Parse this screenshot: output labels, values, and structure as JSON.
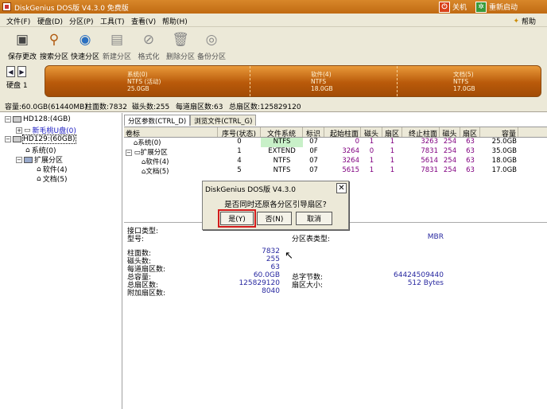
{
  "window": {
    "title": "DiskGenius DOS版 V4.3.0 免费版",
    "shutdown_label": "关机",
    "restart_label": "重新启动"
  },
  "menu": [
    "文件(F)",
    "硬盘(D)",
    "分区(P)",
    "工具(T)",
    "查看(V)",
    "帮助(H)"
  ],
  "help_link": "帮助",
  "toolbar": [
    {
      "label": "保存更改",
      "icon": "disk-save-icon"
    },
    {
      "label": "搜索分区",
      "icon": "magnifier-icon"
    },
    {
      "label": "快速分区",
      "icon": "quick-partition-icon"
    },
    {
      "label": "新建分区",
      "icon": "new-partition-icon"
    },
    {
      "label": "格式化",
      "icon": "format-icon"
    },
    {
      "label": "删除分区",
      "icon": "trash-icon"
    },
    {
      "label": "备份分区",
      "icon": "backup-icon"
    }
  ],
  "disk_nav": {
    "label": "硬盘 1"
  },
  "partitions_bar": [
    {
      "name": "系统(0)",
      "fs": "NTFS (活动)",
      "size": "25.0GB"
    },
    {
      "name": "软件(4)",
      "fs": "NTFS",
      "size": "18.0GB"
    },
    {
      "name": "文档(5)",
      "fs": "NTFS",
      "size": "17.0GB"
    }
  ],
  "disk_info": {
    "capacity": "容量:60.0GB(61440MB)",
    "cylinders": "柱面数:7832",
    "heads": "磁头数:255",
    "sectors_per_track": "每道扇区数:63",
    "total_sectors": "总扇区数:125829120"
  },
  "tree": {
    "hd0": "HD128:(4GB)",
    "hd0_child": "新毛桃U盘(0)",
    "hd1": "HD129:(60GB)",
    "p0": "系统(0)",
    "ext": "扩展分区",
    "p4": "软件(4)",
    "p5": "文档(5)"
  },
  "tabs": [
    "分区参数(CTRL_D)",
    "浏览文件(CTRL_G)"
  ],
  "table": {
    "headers": [
      "卷标",
      "序号(状态)",
      "文件系统",
      "标识",
      "起始柱面",
      "磁头",
      "扇区",
      "终止柱面",
      "磁头",
      "扇区",
      "容量"
    ],
    "rows": [
      [
        "系统(0)",
        "0",
        "NTFS",
        "07",
        "0",
        "1",
        "1",
        "3263",
        "254",
        "63",
        "25.0GB"
      ],
      [
        "扩展分区",
        "1",
        "EXTEND",
        "0F",
        "3264",
        "0",
        "1",
        "7831",
        "254",
        "63",
        "35.0GB"
      ],
      [
        "软件(4)",
        "4",
        "NTFS",
        "07",
        "3264",
        "1",
        "1",
        "5614",
        "254",
        "63",
        "18.0GB"
      ],
      [
        "文档(5)",
        "5",
        "NTFS",
        "07",
        "5615",
        "1",
        "1",
        "7831",
        "254",
        "63",
        "17.0GB"
      ]
    ]
  },
  "details": {
    "interface_type": "接口类型:",
    "model": "型号:",
    "pt_type_label": "分区表类型:",
    "pt_type_value": "MBR",
    "cylinders_label": "柱面数:",
    "cylinders_value": "7832",
    "heads_label": "磁头数:",
    "heads_value": "255",
    "spt_label": "每道扇区数:",
    "spt_value": "63",
    "total_cap_label": "总容量:",
    "total_cap_value": "60.0GB",
    "total_bytes_label": "总字节数:",
    "total_bytes_value": "64424509440",
    "total_sectors_label": "总扇区数:",
    "total_sectors_value": "125829120",
    "sector_size_label": "扇区大小:",
    "sector_size_value": "512 Bytes",
    "extra_sectors_label": "附加扇区数:",
    "extra_sectors_value": "8040"
  },
  "dialog": {
    "title": "DiskGenius DOS版 V4.3.0",
    "message": "是否同时还原各分区引导扇区?",
    "yes": "是(Y)",
    "no": "否(N)",
    "cancel": "取消"
  },
  "colors": {
    "title_bar": "#c8751e",
    "partition_bar": "#b95a0a",
    "highlight": "#d21c1c"
  }
}
